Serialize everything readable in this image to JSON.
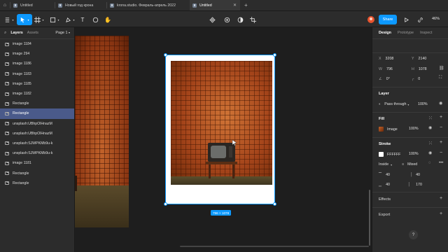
{
  "tabs": [
    {
      "label": "Untitled",
      "active": false
    },
    {
      "label": "Новый год крона",
      "active": false
    },
    {
      "label": "krona.studio. Февраль-апрель 2022",
      "active": false
    },
    {
      "label": "Untitled",
      "active": true
    }
  ],
  "toolbar": {
    "tools": [
      "figma-menu-icon",
      "move-tool-icon",
      "frame-tool-icon",
      "shape-tool-icon",
      "pen-tool-icon",
      "text-tool-icon",
      "comment-icon",
      "hand-tool-icon"
    ],
    "center_tools": [
      "component-icon",
      "mask-icon",
      "contrast-icon",
      "crop-icon"
    ],
    "share_label": "Share",
    "zoom": "46%"
  },
  "left_panel": {
    "tab_layers": "Layers",
    "tab_assets": "Assets",
    "page": "Page 1",
    "layers": [
      {
        "name": "image 1184",
        "selected": false
      },
      {
        "name": "image 294",
        "selected": false
      },
      {
        "name": "image 1186",
        "selected": false
      },
      {
        "name": "image 1183",
        "selected": false
      },
      {
        "name": "image 1185",
        "selected": false
      },
      {
        "name": "image 1182",
        "selected": false
      },
      {
        "name": "Rectangle",
        "selected": false
      },
      {
        "name": "Rectangle",
        "selected": true
      },
      {
        "name": "unsplash:UBhpOlHnazM",
        "selected": false
      },
      {
        "name": "unsplash:UBhpOlHnazM",
        "selected": false
      },
      {
        "name": "unsplash:SJWPKMb9u-k",
        "selected": false
      },
      {
        "name": "unsplash:SJWPKMb9u-k",
        "selected": false
      },
      {
        "name": "image 1181",
        "selected": false
      },
      {
        "name": "Rectangle",
        "selected": false
      },
      {
        "name": "Rectangle",
        "selected": false
      }
    ]
  },
  "canvas": {
    "dimension_badge": "796 × 1078"
  },
  "right_panel": {
    "tab_design": "Design",
    "tab_prototype": "Prototype",
    "tab_inspect": "Inspect",
    "x_label": "X",
    "x_value": "3208",
    "y_label": "Y",
    "y_value": "2140",
    "w_label": "W",
    "w_value": "796",
    "h_label": "H",
    "h_value": "1078",
    "rotation": "0°",
    "radius": "0",
    "layer_title": "Layer",
    "blend_mode": "Pass through",
    "layer_opacity": "100%",
    "fill_title": "Fill",
    "fill_type": "Image",
    "fill_opacity": "100%",
    "stroke_title": "Stroke",
    "stroke_color": "FFFFFF",
    "stroke_color_hex": "#ffffff",
    "stroke_opacity": "100%",
    "stroke_position": "Inside",
    "stroke_weight": "Mixed",
    "stroke_top": "40",
    "stroke_right": "40",
    "stroke_bottom": "40",
    "stroke_left": "170",
    "effects_title": "Effects",
    "export_title": "Export",
    "help": "?"
  },
  "colors": {
    "accent": "#0d99ff",
    "panel": "#2c2c2c",
    "canvas": "#1e1e1e",
    "selection": "#4a5a8a"
  }
}
